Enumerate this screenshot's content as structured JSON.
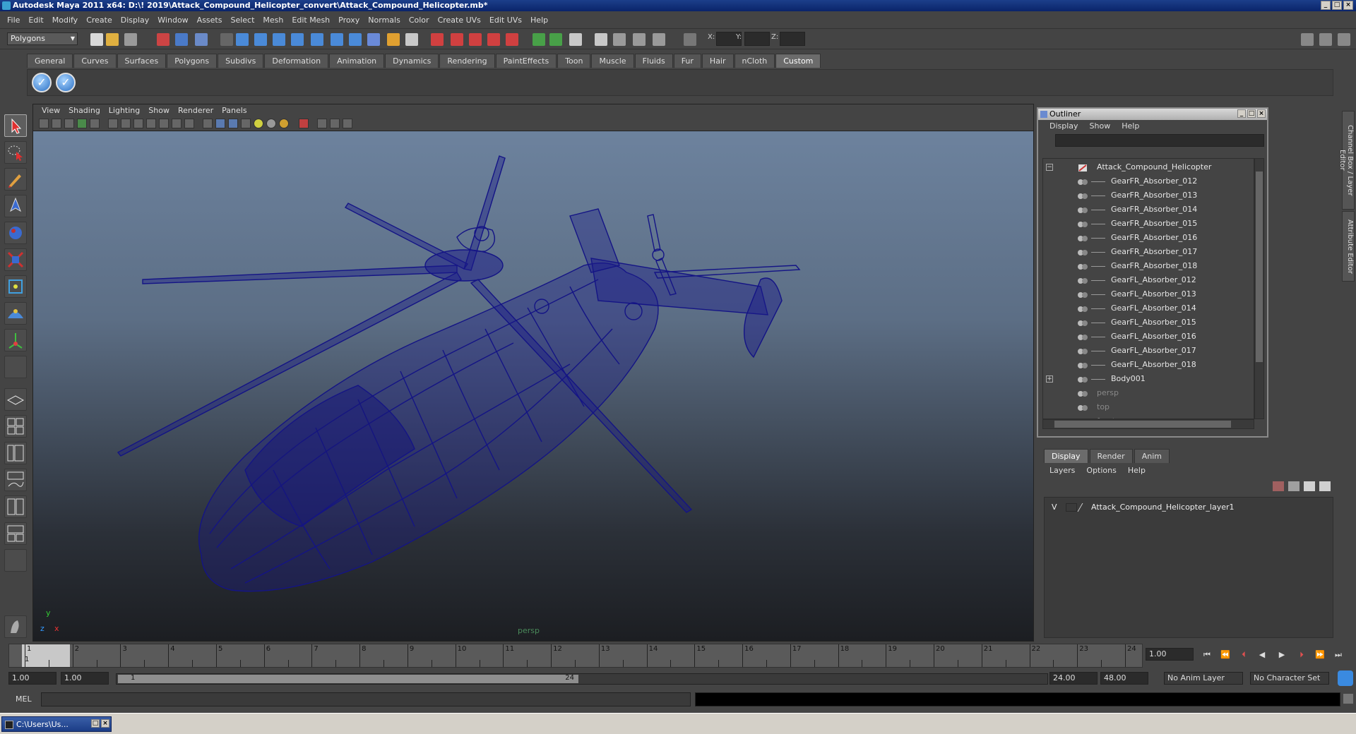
{
  "window": {
    "title": "Autodesk Maya 2011 x64: D:\\! 2019\\Attack_Compound_Helicopter_convert\\Attack_Compound_Helicopter.mb*"
  },
  "menubar": [
    "File",
    "Edit",
    "Modify",
    "Create",
    "Display",
    "Window",
    "Assets",
    "Select",
    "Mesh",
    "Edit Mesh",
    "Proxy",
    "Normals",
    "Color",
    "Create UVs",
    "Edit UVs",
    "Help"
  ],
  "toolbar": {
    "mode": "Polygons",
    "x_label": "X:",
    "y_label": "Y:",
    "z_label": "Z:"
  },
  "shelf_tabs": [
    "General",
    "Curves",
    "Surfaces",
    "Polygons",
    "Subdivs",
    "Deformation",
    "Animation",
    "Dynamics",
    "Rendering",
    "PaintEffects",
    "Toon",
    "Muscle",
    "Fluids",
    "Fur",
    "Hair",
    "nCloth",
    "Custom"
  ],
  "active_shelf_tab": "Custom",
  "viewport": {
    "menu": [
      "View",
      "Shading",
      "Lighting",
      "Show",
      "Renderer",
      "Panels"
    ],
    "camera_label": "persp",
    "axis_y": "y",
    "axis_x": "x",
    "axis_z": "z",
    "wire_color": "#1a1a8a"
  },
  "outliner": {
    "title": "Outliner",
    "menu": [
      "Display",
      "Show",
      "Help"
    ],
    "items": [
      {
        "label": "Attack_Compound_Helicopter",
        "level": 0,
        "expander": "−"
      },
      {
        "label": "GearFR_Absorber_012",
        "level": 1
      },
      {
        "label": "GearFR_Absorber_013",
        "level": 1
      },
      {
        "label": "GearFR_Absorber_014",
        "level": 1
      },
      {
        "label": "GearFR_Absorber_015",
        "level": 1
      },
      {
        "label": "GearFR_Absorber_016",
        "level": 1
      },
      {
        "label": "GearFR_Absorber_017",
        "level": 1
      },
      {
        "label": "GearFR_Absorber_018",
        "level": 1
      },
      {
        "label": "GearFL_Absorber_012",
        "level": 1
      },
      {
        "label": "GearFL_Absorber_013",
        "level": 1
      },
      {
        "label": "GearFL_Absorber_014",
        "level": 1
      },
      {
        "label": "GearFL_Absorber_015",
        "level": 1
      },
      {
        "label": "GearFL_Absorber_016",
        "level": 1
      },
      {
        "label": "GearFL_Absorber_017",
        "level": 1
      },
      {
        "label": "GearFL_Absorber_018",
        "level": 1
      },
      {
        "label": "Body001",
        "level": 1,
        "expander": "+"
      },
      {
        "label": "persp",
        "level": 0,
        "dim": true
      },
      {
        "label": "top",
        "level": 0,
        "dim": true
      },
      {
        "label": "front",
        "level": 0,
        "dim": true
      }
    ]
  },
  "side_tabs": [
    "Channel Box / Layer Editor",
    "Attribute Editor"
  ],
  "layer_editor": {
    "tabs": [
      "Display",
      "Render",
      "Anim"
    ],
    "active_tab": "Display",
    "menu": [
      "Layers",
      "Options",
      "Help"
    ],
    "layers": [
      {
        "visible": "V",
        "name": "Attack_Compound_Helicopter_layer1"
      }
    ]
  },
  "timeline": {
    "ticks": [
      "1",
      "2",
      "3",
      "4",
      "5",
      "6",
      "7",
      "8",
      "9",
      "10",
      "11",
      "12",
      "13",
      "14",
      "15",
      "16",
      "17",
      "18",
      "19",
      "20",
      "21",
      "22",
      "23",
      "24"
    ],
    "current_tick_label": "1",
    "current_frame": "1.00"
  },
  "range": {
    "start": "1.00",
    "playback_start": "1.00",
    "slider_start": "1",
    "slider_end": "24",
    "playback_end": "24.00",
    "end": "48.00",
    "anim_layer": "No Anim Layer",
    "character_set": "No Character Set"
  },
  "command_line": {
    "label": "MEL"
  },
  "taskbar": {
    "item": "C:\\Users\\Us..."
  }
}
